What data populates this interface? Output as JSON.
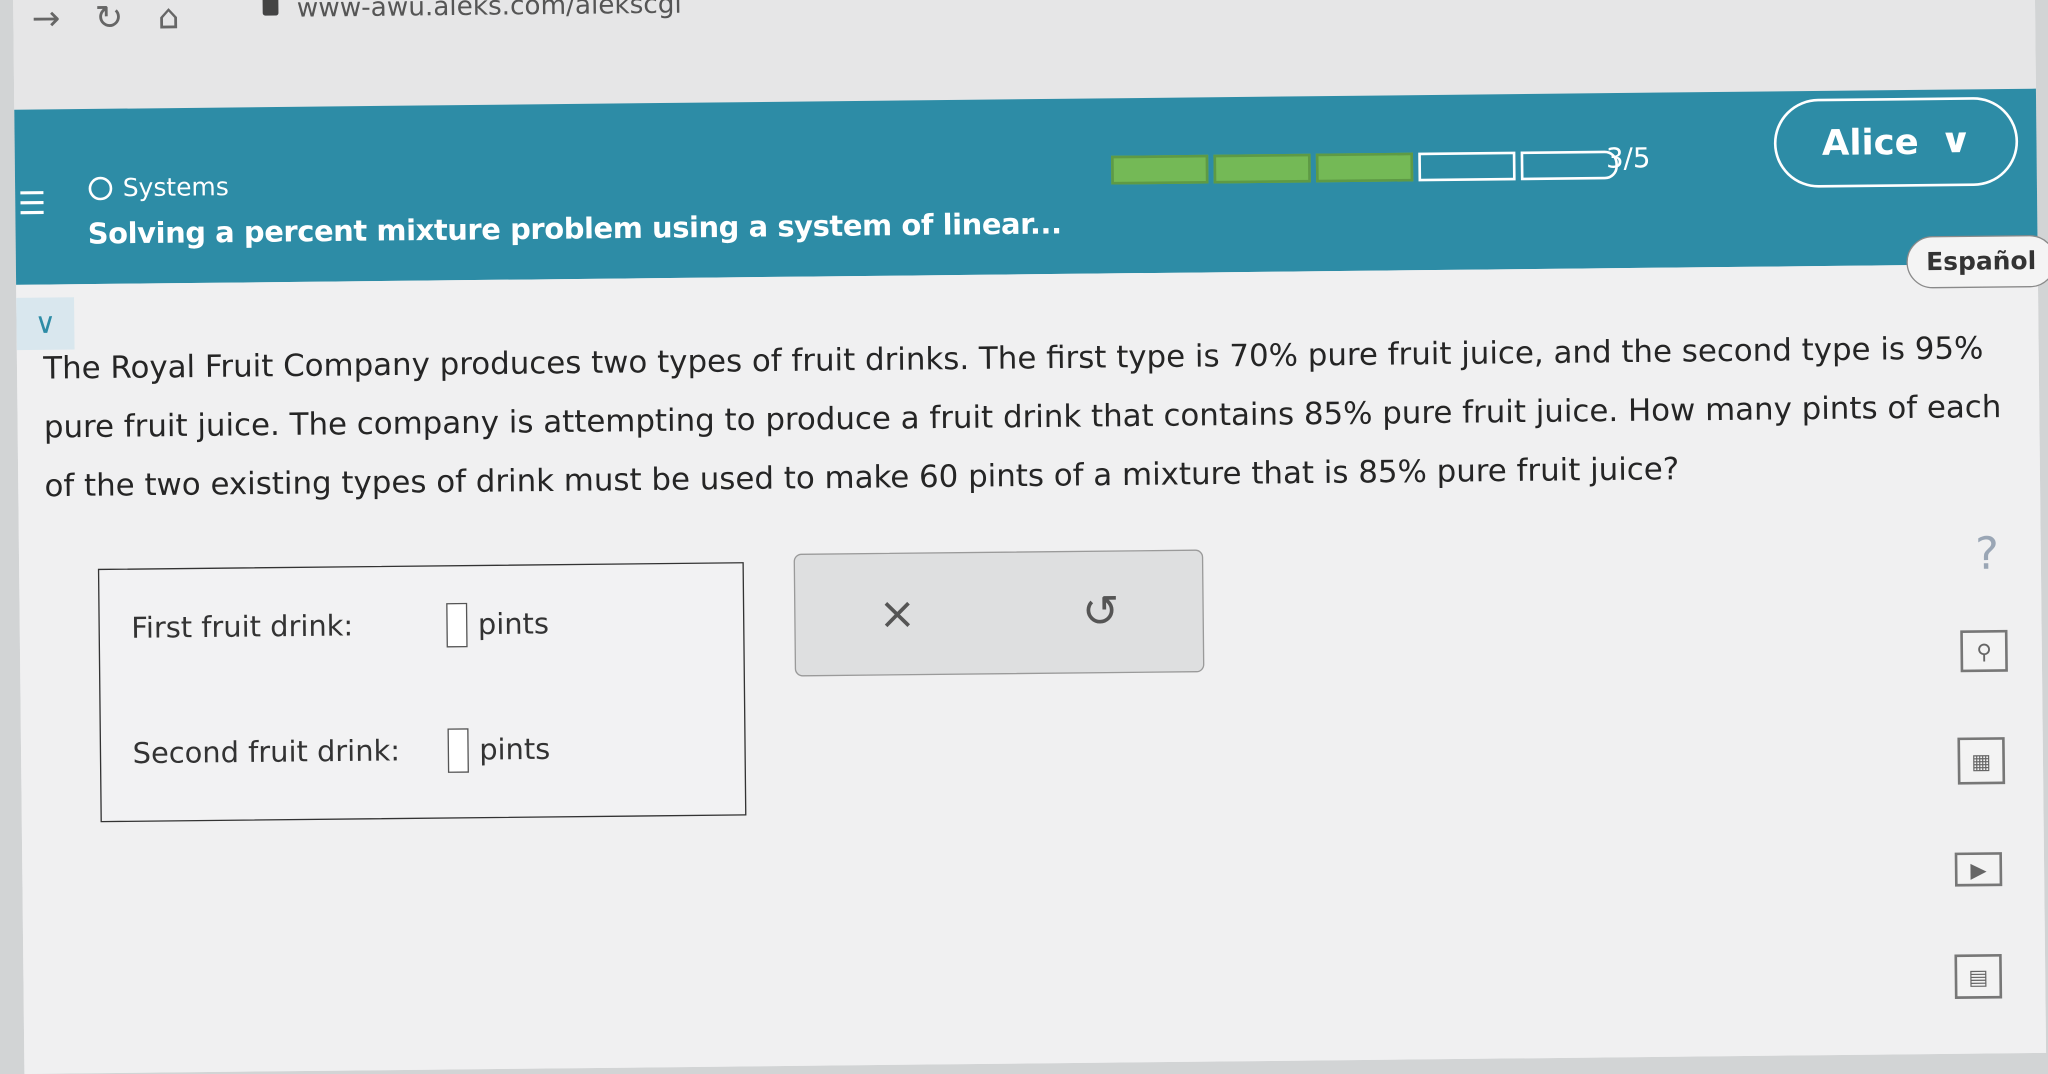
{
  "browser": {
    "url": "www-awu.aleks.com/alekscgi"
  },
  "header": {
    "section": "Systems",
    "topic": "Solving a percent mixture problem using a system of linear...",
    "progress": {
      "completed": 3,
      "total": 5,
      "label": "3/5"
    },
    "user_name": "Alice"
  },
  "language_button": "Español",
  "problem_text": "The Royal Fruit Company produces two types of fruit drinks. The first type is 70% pure fruit juice, and the second type is 95% pure fruit juice. The company is attempting to produce a fruit drink that contains 85% pure fruit juice. How many pints of each of the two existing types of drink must be used to make 60 pints of a mixture that is 85% pure fruit juice?",
  "answers": [
    {
      "label": "First fruit drink:",
      "value": "",
      "unit": "pints"
    },
    {
      "label": "Second fruit drink:",
      "value": "",
      "unit": "pints"
    }
  ],
  "actions": {
    "clear_symbol": "×",
    "undo_symbol": "↺"
  },
  "tools": {
    "help_symbol": "?",
    "icons": [
      "help-icon",
      "glossary-icon",
      "calculator-icon",
      "video-icon",
      "worksheet-icon"
    ]
  },
  "colors": {
    "header_teal": "#2d8ca6",
    "progress_green": "#74b956"
  }
}
